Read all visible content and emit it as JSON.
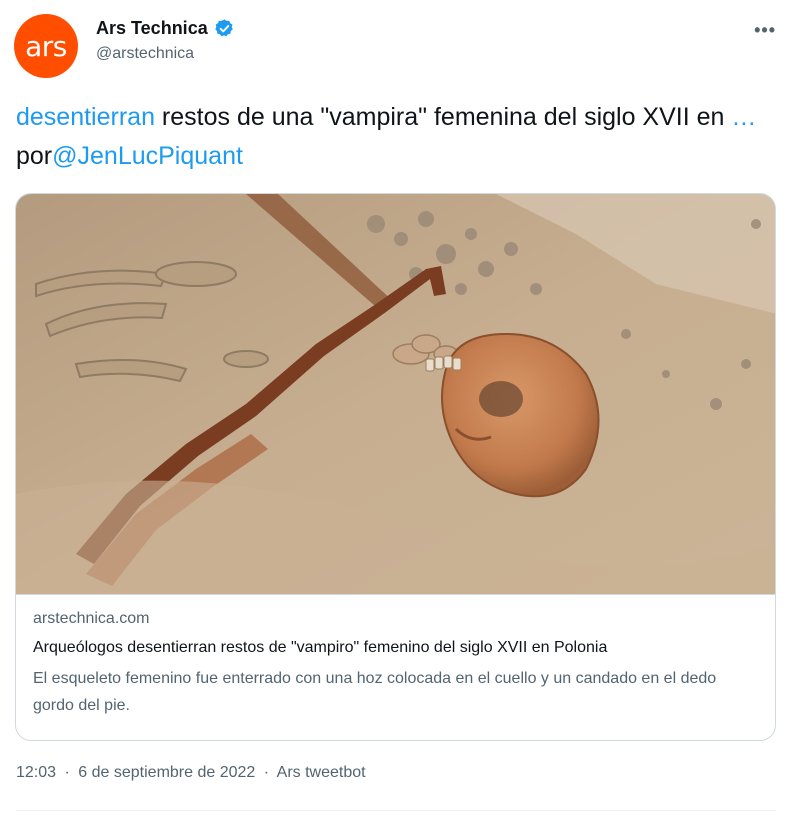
{
  "author": {
    "avatar_text": "ars",
    "avatar_color": "#ff4e00",
    "display_name": "Ars Technica",
    "handle": "@arstechnica",
    "verified": true
  },
  "more_icon": "more-horizontal-icon",
  "tweet": {
    "part1_link": "desentierran",
    "part2": " restos de una \"vampira\" femenina del siglo XVII en ",
    "ellipsis_link": "…",
    "part3": " por",
    "mention_link": "@JenLucPiquant"
  },
  "card": {
    "image_alt": "skeleton with sickle at neck in sandy excavation",
    "domain": "arstechnica.com",
    "title": "Arqueólogos desentierran restos de \"vampiro\" femenino del siglo XVII en Polonia",
    "description": "El esqueleto femenino fue enterrado con una hoz colocada en el cuello y un candado en el dedo gordo del pie."
  },
  "meta": {
    "time": "12:03",
    "separator1": "·",
    "date": "6 de septiembre de 2022",
    "separator2": "·",
    "source": "Ars tweetbot"
  },
  "colors": {
    "link": "#1d9bf0",
    "secondary_text": "#536471",
    "border": "#cfd9de"
  }
}
